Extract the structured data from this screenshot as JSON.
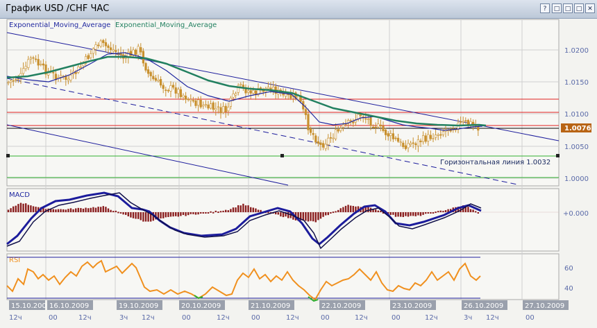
{
  "window": {
    "title": "График USD /CHF  ЧАС",
    "buttons": [
      "?",
      "□",
      "□",
      "□",
      "✕"
    ]
  },
  "main": {
    "legend": [
      "Exponential_Moving_Average",
      "Exponential_Moving_Average"
    ],
    "price_axis": [
      "1.0200",
      "1.0150",
      "1.0100",
      "1.0050",
      "1.0000"
    ],
    "current_price": "1.0076",
    "horizontal_line_label": "Горизонтальная линия 1.0032"
  },
  "macd": {
    "label": "MACD",
    "axis": [
      "+0.000"
    ]
  },
  "rsi": {
    "label": "RSI",
    "axis": [
      "60",
      "40"
    ]
  },
  "time_axis": {
    "dates": [
      "15.10.2009",
      "16.10.2009",
      "19.10.2009",
      "20.10.2009",
      "21.10.2009",
      "22.10.2009",
      "23.10.2009",
      "26.10.2009",
      "27.10.2009"
    ],
    "hours": [
      "12ч",
      "00",
      "12ч",
      "3ч",
      "12ч",
      "00",
      "12ч",
      "00",
      "12ч",
      "00",
      "12ч",
      "00",
      "12ч",
      "3ч",
      "12ч",
      "00"
    ]
  },
  "colors": {
    "candle": "#c8902e",
    "ema_fast": "#2028a0",
    "ema_slow": "#228060",
    "channel": "#1c1c9c",
    "red_level": "#e02020",
    "green_level": "#30b030",
    "macd_hist": "#8a1e1e",
    "rsi_line": "#f0901e"
  }
}
